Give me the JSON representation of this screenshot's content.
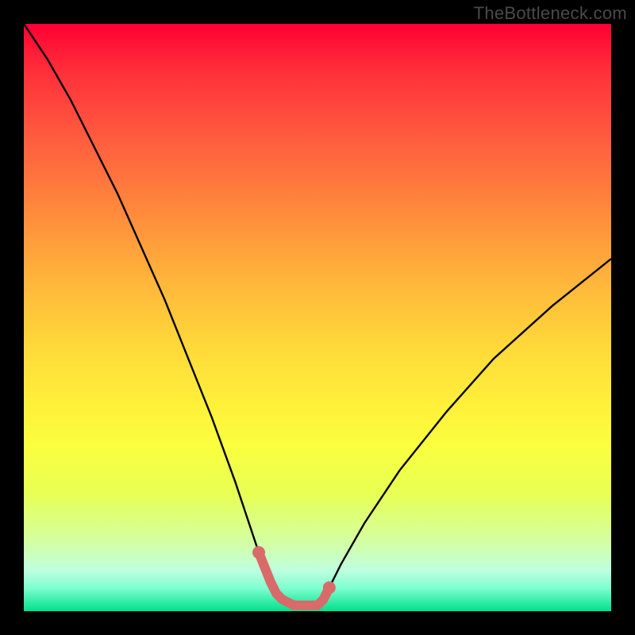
{
  "watermark": {
    "text": "TheBottleneck.com"
  },
  "chart_data": {
    "type": "line",
    "title": "",
    "xlabel": "",
    "ylabel": "",
    "xlim": [
      0,
      100
    ],
    "ylim": [
      0,
      100
    ],
    "series": [
      {
        "name": "bottleneck-curve",
        "x": [
          0,
          4,
          8,
          12,
          16,
          20,
          24,
          28,
          32,
          36,
          38,
          40,
          42,
          43,
          44,
          46,
          48,
          50,
          51,
          52,
          54,
          58,
          64,
          72,
          80,
          90,
          100
        ],
        "y": [
          100,
          94,
          87,
          79,
          71,
          62,
          53,
          43,
          33,
          22,
          16,
          10,
          5,
          3,
          2,
          1,
          1,
          1,
          2,
          4,
          8,
          15,
          24,
          34,
          43,
          52,
          60
        ]
      },
      {
        "name": "sweet-spot-highlight",
        "x": [
          40,
          42,
          43,
          44,
          46,
          48,
          50,
          51,
          52
        ],
        "y": [
          10,
          5,
          3,
          2,
          1,
          1,
          1,
          2,
          4
        ]
      }
    ],
    "highlight_color": "#d86a6a",
    "curve_color": "#000000"
  }
}
